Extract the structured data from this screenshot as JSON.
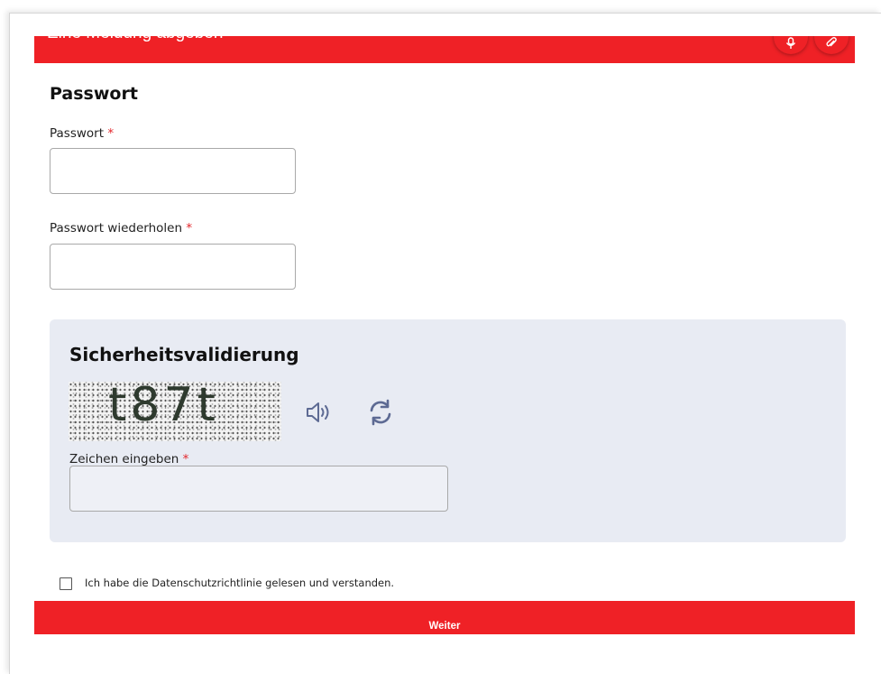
{
  "theme": {
    "accent": "#ef2126",
    "panel": "#e8ebf3",
    "icon": "#5d6a93"
  },
  "header": {
    "title": "Eine Meldung abgeben",
    "mic_icon": "microphone-icon",
    "attach_icon": "paperclip-icon"
  },
  "password_section": {
    "title": "Passwort",
    "password_label": "Passwort",
    "password_value": "",
    "repeat_label": "Passwort wiederholen",
    "repeat_value": "",
    "required_marker": "*"
  },
  "captcha": {
    "title": "Sicherheitsvalidierung",
    "image_text": "t87t",
    "audio_icon": "speaker-icon",
    "refresh_icon": "refresh-icon",
    "input_label": "Zeichen eingeben",
    "input_value": ""
  },
  "privacy": {
    "checked": false,
    "label": "Ich habe die Datenschutzrichtlinie gelesen und verstanden."
  },
  "footer": {
    "submit_label": "Weiter"
  }
}
